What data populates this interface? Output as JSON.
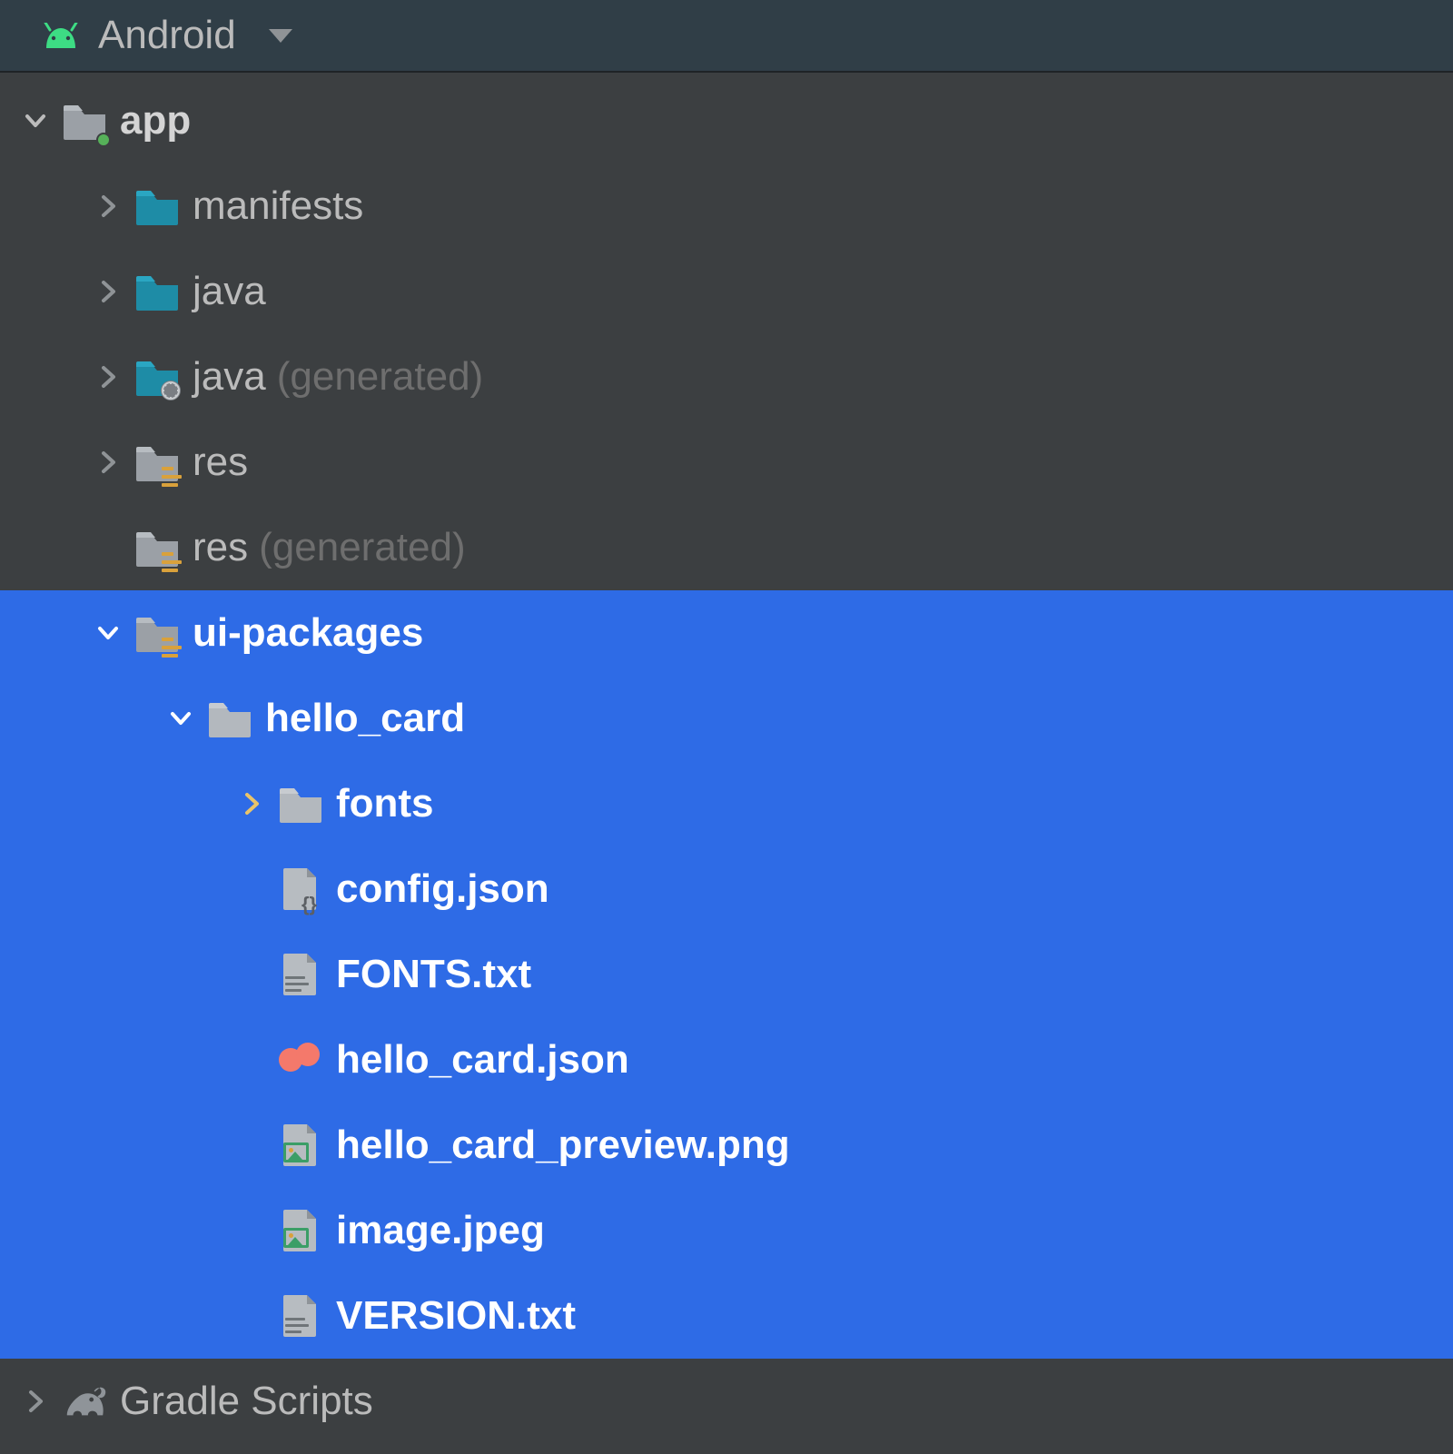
{
  "header": {
    "title": "Android"
  },
  "tree": {
    "app": {
      "label": "app"
    },
    "manifests": {
      "label": "manifests"
    },
    "java": {
      "label": "java"
    },
    "java_gen": {
      "label": "java",
      "suffix": "(generated)"
    },
    "res": {
      "label": "res"
    },
    "res_gen": {
      "label": "res",
      "suffix": "(generated)"
    },
    "ui_packages": {
      "label": "ui-packages"
    },
    "hello_card": {
      "label": "hello_card"
    },
    "fonts": {
      "label": "fonts"
    },
    "config_json": {
      "label": "config.json"
    },
    "fonts_txt": {
      "label": "FONTS.txt"
    },
    "hello_card_json": {
      "label": "hello_card.json"
    },
    "preview_png": {
      "label": "hello_card_preview.png"
    },
    "image_jpeg": {
      "label": "image.jpeg"
    },
    "version_txt": {
      "label": "VERSION.txt"
    },
    "gradle": {
      "label": "Gradle Scripts"
    }
  },
  "colors": {
    "selection": "#2e6be6",
    "folder_teal": "#1e8ca6",
    "folder_grey": "#9ba0a6",
    "android_green": "#3ddc84"
  }
}
